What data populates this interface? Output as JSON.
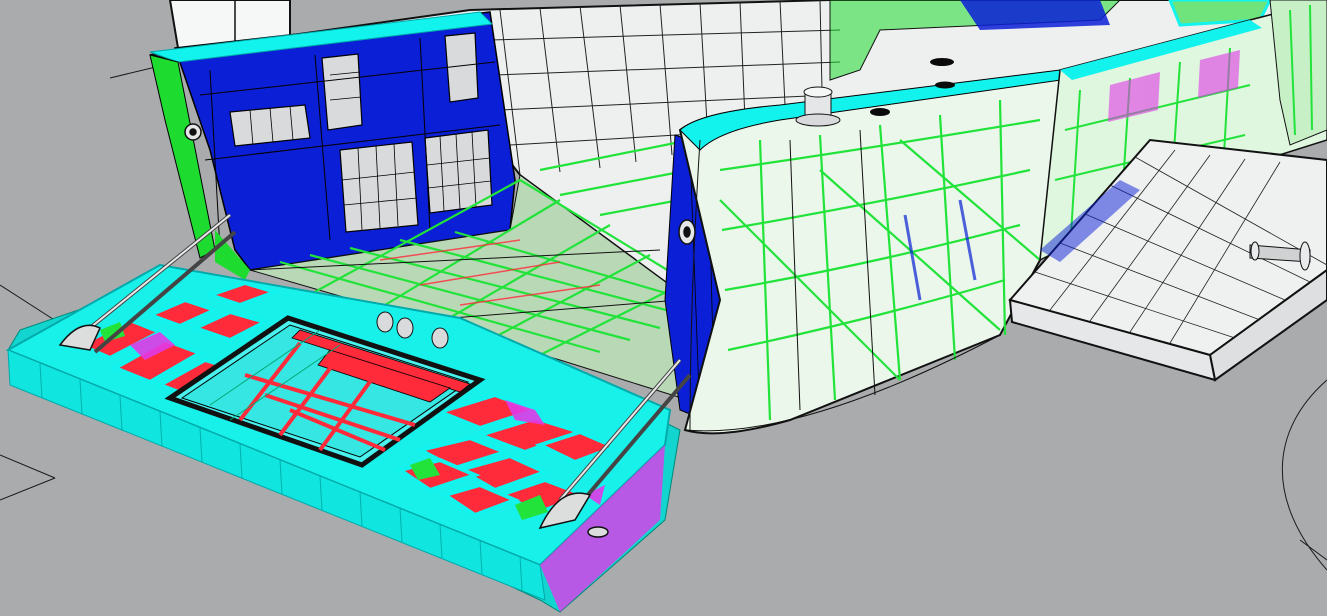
{
  "viewport": {
    "background_color": "#a9abad",
    "display_mode": "ghosted-wireframe",
    "colors": {
      "hull_white": "#f2f4f4",
      "wire": "#111111",
      "bulkhead_blue": "#0a1fd6",
      "edge_cyan": "#13f3ee",
      "frame_green": "#22e33a",
      "compartment_red": "#ff2a3a",
      "compartment_magenta": "#e13ae8",
      "grid_line": "#1a1a1a"
    }
  },
  "model": {
    "parts": [
      {
        "name": "stern-hull",
        "color": "hull_white"
      },
      {
        "name": "transom-bulkhead",
        "color": "bulkhead_blue"
      },
      {
        "name": "stern-ramp",
        "color": "edge_cyan"
      },
      {
        "name": "ramp-compartments",
        "color": "compartment_red"
      },
      {
        "name": "well-deck-framing",
        "color": "frame_green"
      },
      {
        "name": "starboard-sponson",
        "color": "frame_green"
      },
      {
        "name": "side-walkway-platform",
        "color": "hull_white"
      },
      {
        "name": "bollard",
        "color": "hull_white"
      },
      {
        "name": "mooring-pin",
        "color": "hull_white"
      }
    ]
  }
}
